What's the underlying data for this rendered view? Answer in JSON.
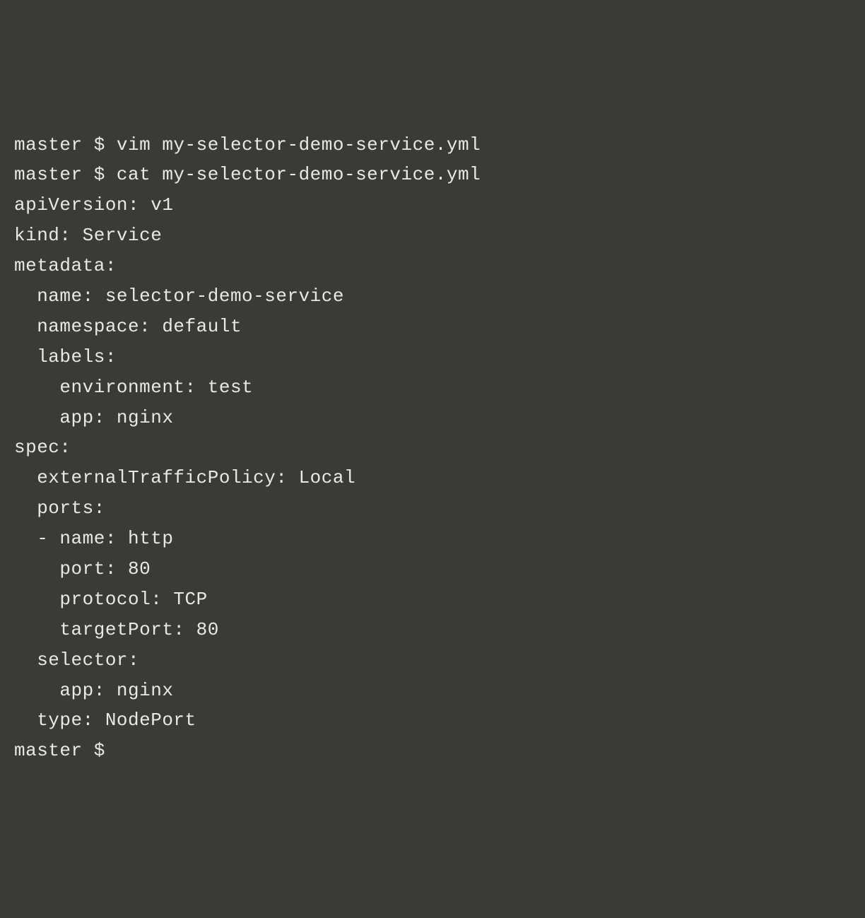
{
  "terminal": {
    "lines": [
      "master $ vim my-selector-demo-service.yml",
      "master $ cat my-selector-demo-service.yml",
      "apiVersion: v1",
      "kind: Service",
      "metadata:",
      "  name: selector-demo-service",
      "  namespace: default",
      "  labels:",
      "    environment: test",
      "    app: nginx",
      "spec:",
      "  externalTrafficPolicy: Local",
      "  ports:",
      "  - name: http",
      "    port: 80",
      "    protocol: TCP",
      "    targetPort: 80",
      "  selector:",
      "    app: nginx",
      "  type: NodePort",
      "master $"
    ]
  }
}
